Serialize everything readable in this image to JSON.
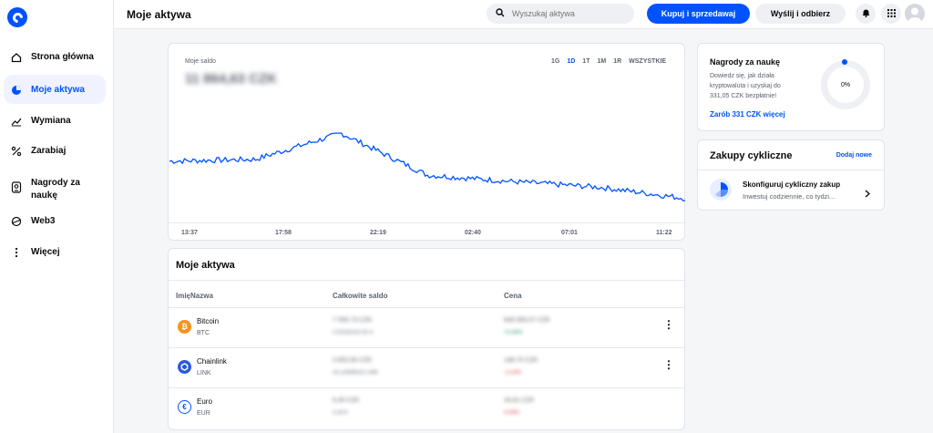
{
  "sidebar": {
    "items": [
      {
        "label": "Strona główna",
        "icon": "home-icon",
        "active": false
      },
      {
        "label": "Moje aktywa",
        "icon": "pie-chart-icon",
        "active": true
      },
      {
        "label": "Wymiana",
        "icon": "trend-icon",
        "active": false
      },
      {
        "label": "Zarabiaj",
        "icon": "percent-icon",
        "active": false
      },
      {
        "label": "Nagrody za naukę",
        "icon": "reward-icon",
        "active": false
      },
      {
        "label": "Web3",
        "icon": "web3-icon",
        "active": false
      },
      {
        "label": "Więcej",
        "icon": "more-icon",
        "active": false
      }
    ]
  },
  "header": {
    "title": "Moje aktywa",
    "search_placeholder": "Wyszukaj aktywa",
    "buy_sell_label": "Kupuj i sprzedawaj",
    "send_receive_label": "Wyślij i odbierz"
  },
  "balance": {
    "label": "Moje saldo",
    "amount": "11 864,63 CZK",
    "ranges": [
      "1G",
      "1D",
      "1T",
      "1M",
      "1R",
      "WSZYSTKIE"
    ],
    "active_range": "1D",
    "time_labels": [
      "13:37",
      "17:58",
      "22:19",
      "02:40",
      "07:01",
      "11:22"
    ]
  },
  "chart_data": {
    "type": "line",
    "x": [
      "13:37",
      "17:58",
      "22:19",
      "02:40",
      "07:01",
      "11:22"
    ],
    "series": [
      {
        "values": [
          60,
          62,
          90,
          45,
          38,
          32,
          20
        ]
      }
    ],
    "color": "#0052ff"
  },
  "assets": {
    "title": "Moje aktywa",
    "columns": [
      "ImięNazwa",
      "Całkowite saldo",
      "Cena"
    ],
    "rows": [
      {
        "name": "Bitcoin",
        "ticker": "BTC",
        "icon": "bitcoin-icon",
        "color": "#f7931a",
        "glyph": "₿",
        "balance": "7 555,73 CZK",
        "balance_sub": "0,00283310 BTC",
        "price": "649 565,07 CZK",
        "change": "+0,44%",
        "change_color": "#098551"
      },
      {
        "name": "Chainlink",
        "ticker": "LINK",
        "icon": "chainlink-icon",
        "color": "#2a5ada",
        "glyph": "⬡",
        "balance": "3 602,50 CZK",
        "balance_sub": "24,22698553 LINK",
        "price": "148,70 CZK",
        "change": "-2,23%",
        "change_color": "#cf202f"
      },
      {
        "name": "Euro",
        "ticker": "EUR",
        "icon": "euro-icon",
        "color": "#0052ff",
        "glyph": "€",
        "balance": "6,40 CZK",
        "balance_sub": "0,26 €",
        "price": "24,61 CZK",
        "change": "0,04%",
        "change_color": "#cf202f"
      }
    ]
  },
  "rewards": {
    "title": "Nagrody za naukę",
    "text": "Dowiedz się, jak działa kryptowaluta i uzyskaj do 331,05 CZK bezpłatnie!",
    "link": "Zarób 331 CZK więcej",
    "progress": "0%",
    "progress_value": 0
  },
  "recurring": {
    "title": "Zakupy cykliczne",
    "add_label": "Dodaj nowe",
    "item_title": "Skonfiguruj cykliczny zakup",
    "item_sub": "Inwestuj codziennie, co tydzi..."
  }
}
